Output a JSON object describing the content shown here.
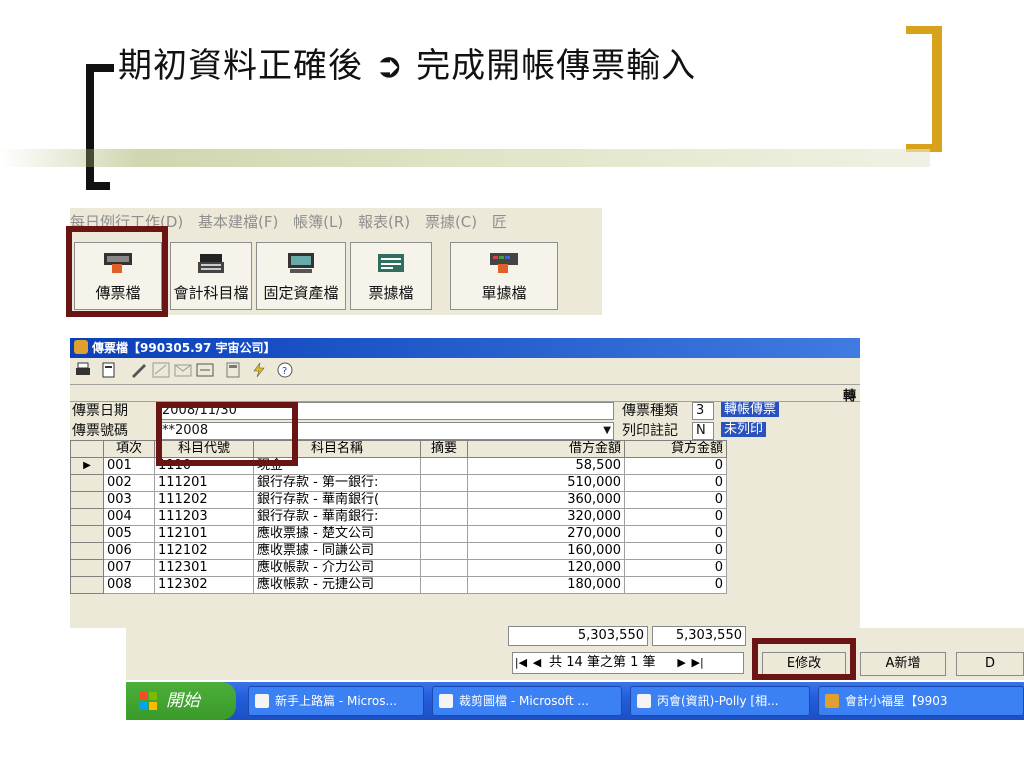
{
  "slide": {
    "title": "期初資料正確後 ➲ 完成開帳傳票輸入"
  },
  "menubar": {
    "items": [
      "每日例行工作(D)",
      "基本建檔(F)",
      "帳簿(L)",
      "報表(R)",
      "票據(C)",
      "匠"
    ]
  },
  "toolbar": {
    "buttons": [
      {
        "label": "傳票檔",
        "icon": "keyboard-hand-icon"
      },
      {
        "label": "會計科目檔",
        "icon": "register-icon"
      },
      {
        "label": "固定資產檔",
        "icon": "monitor-icon"
      },
      {
        "label": "票據檔",
        "icon": "check-icon"
      },
      {
        "label": "單據檔",
        "icon": "keyboard-hand-icon"
      }
    ]
  },
  "window": {
    "title": "傳票檔【990305.97 宇宙公司】",
    "corner_tag": "轉",
    "fields": {
      "date_label": "傳票日期",
      "date_value": "2008/11/30",
      "number_label": "傳票號碼",
      "number_value": "**2008",
      "type_label": "傳票種類",
      "type_code": "3",
      "type_value": "轉帳傳票",
      "print_label": "列印註記",
      "print_code": "N",
      "print_value": "未列印"
    },
    "columns": [
      "項次",
      "科目代號",
      "科目名稱",
      "摘要",
      "借方金額",
      "貸方金額"
    ],
    "rows": [
      [
        "001",
        "1110",
        "現金",
        "",
        "58,500",
        "0"
      ],
      [
        "002",
        "111201",
        "銀行存款 - 第一銀行:",
        "",
        "510,000",
        "0"
      ],
      [
        "003",
        "111202",
        "銀行存款 - 華南銀行(",
        "",
        "360,000",
        "0"
      ],
      [
        "004",
        "111203",
        "銀行存款 - 華南銀行:",
        "",
        "320,000",
        "0"
      ],
      [
        "005",
        "112101",
        "應收票據 - 楚文公司",
        "",
        "270,000",
        "0"
      ],
      [
        "006",
        "112102",
        "應收票據 - 同謙公司",
        "",
        "160,000",
        "0"
      ],
      [
        "007",
        "112301",
        "應收帳款 - 介力公司",
        "",
        "120,000",
        "0"
      ],
      [
        "008",
        "112302",
        "應收帳款 - 元捷公司",
        "",
        "180,000",
        "0"
      ]
    ],
    "totals": {
      "debit": "5,303,550",
      "credit": "5,303,550"
    },
    "nav": {
      "record_text": "共 14 筆之第 1 筆"
    },
    "actions": {
      "edit": "E修改",
      "add": "A新增",
      "delete": "D"
    }
  },
  "taskbar": {
    "start_label": "開始",
    "tasks": [
      "新手上路篇 - Micros...",
      "裁剪圖檔 - Microsoft ...",
      "丙會(資訊)-Polly [相...",
      "會計小福星【9903"
    ]
  },
  "colors": {
    "highlight": "#6b1414",
    "bracket_gold": "#d8a21c",
    "titlebar_blue": "#0a3fb8",
    "selection_blue": "#2a52be"
  }
}
